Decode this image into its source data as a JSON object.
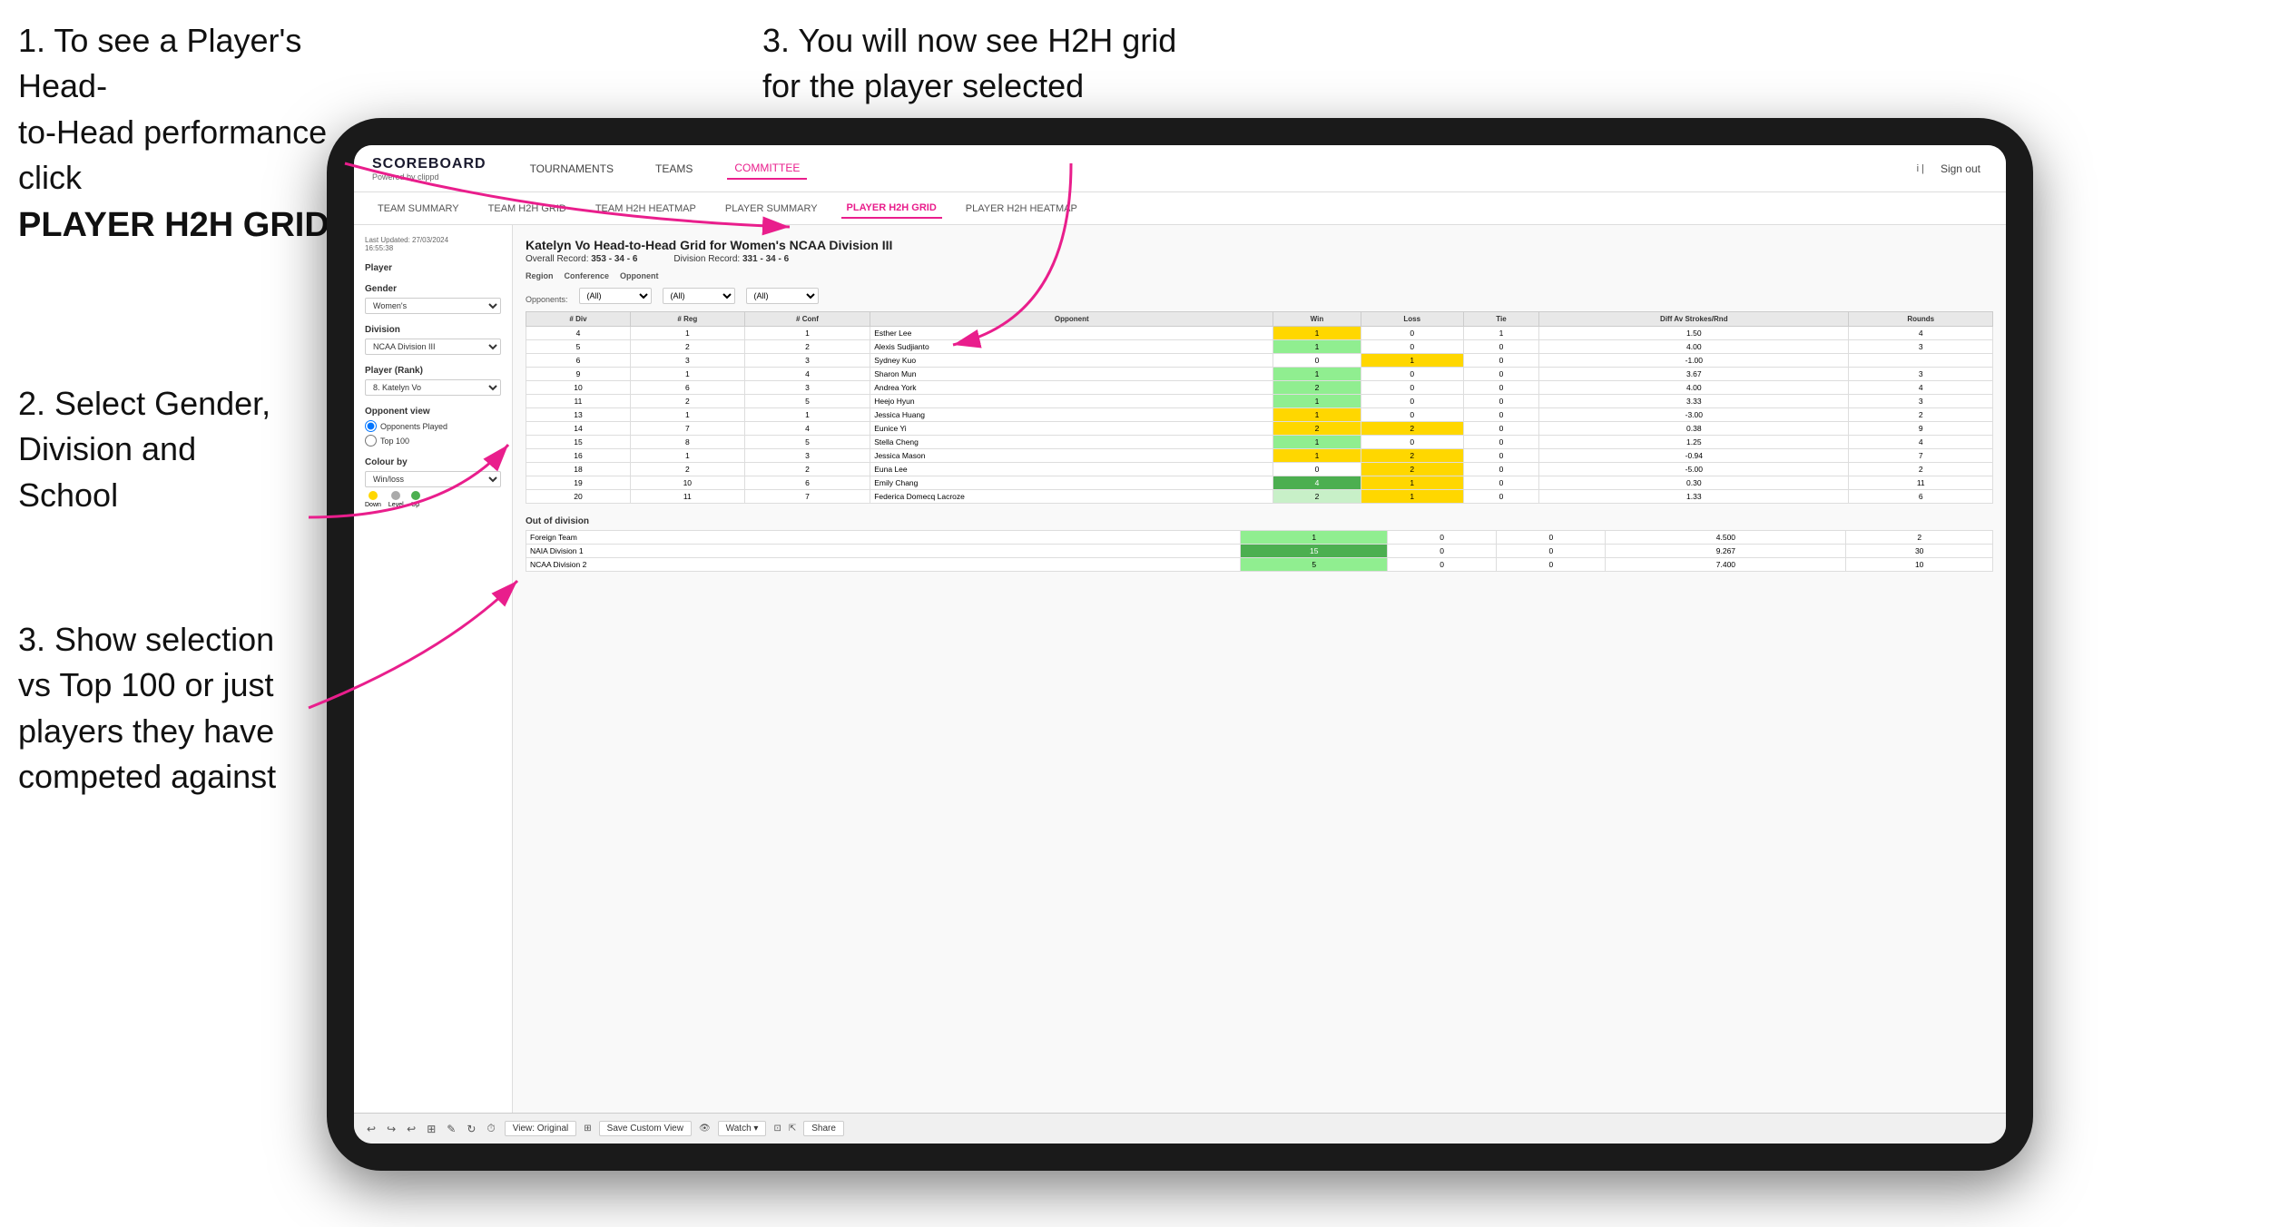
{
  "instructions": {
    "step1_line1": "1. To see a Player's Head-",
    "step1_line2": "to-Head performance click",
    "step1_bold": "PLAYER H2H GRID",
    "step2_line1": "2. Select Gender,",
    "step2_line2": "Division and",
    "step2_line3": "School",
    "step3_top_line1": "3. You will now see H2H grid",
    "step3_top_line2": "for the player selected",
    "step3_bottom_line1": "3. Show selection",
    "step3_bottom_line2": "vs Top 100 or just",
    "step3_bottom_line3": "players they have",
    "step3_bottom_line4": "competed against"
  },
  "nav": {
    "logo": "SCOREBOARD",
    "logo_sub": "Powered by clippd",
    "links": [
      "TOURNAMENTS",
      "TEAMS",
      "COMMITTEE"
    ],
    "active_link": "COMMITTEE",
    "sign_out": "Sign out"
  },
  "sub_nav": {
    "links": [
      "TEAM SUMMARY",
      "TEAM H2H GRID",
      "TEAM H2H HEATMAP",
      "PLAYER SUMMARY",
      "PLAYER H2H GRID",
      "PLAYER H2H HEATMAP"
    ],
    "active": "PLAYER H2H GRID"
  },
  "sidebar": {
    "timestamp": "Last Updated: 27/03/2024",
    "timestamp2": "16:55:38",
    "player_label": "Player",
    "gender_label": "Gender",
    "gender_value": "Women's",
    "division_label": "Division",
    "division_value": "NCAA Division III",
    "player_rank_label": "Player (Rank)",
    "player_rank_value": "8. Katelyn Vo",
    "opponent_view_label": "Opponent view",
    "opponent_played": "Opponents Played",
    "top_100": "Top 100",
    "colour_by_label": "Colour by",
    "colour_by_value": "Win/loss",
    "legend_down": "Down",
    "legend_level": "Level",
    "legend_up": "Up"
  },
  "grid": {
    "title": "Katelyn Vo Head-to-Head Grid for Women's NCAA Division III",
    "overall_record_label": "Overall Record:",
    "overall_record": "353 - 34 - 6",
    "division_record_label": "Division Record:",
    "division_record": "331 - 34 - 6",
    "region_label": "Region",
    "conference_label": "Conference",
    "opponent_label": "Opponent",
    "opponents_label": "Opponents:",
    "opponents_value": "(All)",
    "conference_value": "(All)",
    "opponent_value": "(All)",
    "col_headers": [
      "# Div",
      "# Reg",
      "# Conf",
      "Opponent",
      "Win",
      "Loss",
      "Tie",
      "Diff Av Strokes/Rnd",
      "Rounds"
    ],
    "rows": [
      {
        "div": 4,
        "reg": 1,
        "conf": 1,
        "opponent": "Esther Lee",
        "win": 1,
        "loss": 0,
        "tie": 1,
        "diff": "1.50",
        "rounds": 4,
        "win_color": "yellow",
        "loss_color": "",
        "tie_color": "yellow"
      },
      {
        "div": 5,
        "reg": 2,
        "conf": 2,
        "opponent": "Alexis Sudjianto",
        "win": 1,
        "loss": 0,
        "tie": 0,
        "diff": "4.00",
        "rounds": 3,
        "win_color": "green",
        "loss_color": "",
        "tie_color": ""
      },
      {
        "div": 6,
        "reg": 3,
        "conf": 3,
        "opponent": "Sydney Kuo",
        "win": 0,
        "loss": 1,
        "tie": 0,
        "diff": "-1.00",
        "rounds": "",
        "win_color": "",
        "loss_color": "yellow",
        "tie_color": ""
      },
      {
        "div": 9,
        "reg": 1,
        "conf": 4,
        "opponent": "Sharon Mun",
        "win": 1,
        "loss": 0,
        "tie": 0,
        "diff": "3.67",
        "rounds": 3,
        "win_color": "green",
        "loss_color": "",
        "tie_color": ""
      },
      {
        "div": 10,
        "reg": 6,
        "conf": 3,
        "opponent": "Andrea York",
        "win": 2,
        "loss": 0,
        "tie": 0,
        "diff": "4.00",
        "rounds": 4,
        "win_color": "green",
        "loss_color": "",
        "tie_color": ""
      },
      {
        "div": 11,
        "reg": 2,
        "conf": 5,
        "opponent": "Heejo Hyun",
        "win": 1,
        "loss": 0,
        "tie": 0,
        "diff": "3.33",
        "rounds": 3,
        "win_color": "green",
        "loss_color": "",
        "tie_color": ""
      },
      {
        "div": 13,
        "reg": 1,
        "conf": 1,
        "opponent": "Jessica Huang",
        "win": 1,
        "loss": 0,
        "tie": 0,
        "diff": "-3.00",
        "rounds": 2,
        "win_color": "yellow",
        "loss_color": "",
        "tie_color": ""
      },
      {
        "div": 14,
        "reg": 7,
        "conf": 4,
        "opponent": "Eunice Yi",
        "win": 2,
        "loss": 2,
        "tie": 0,
        "diff": "0.38",
        "rounds": 9,
        "win_color": "yellow",
        "loss_color": "yellow",
        "tie_color": ""
      },
      {
        "div": 15,
        "reg": 8,
        "conf": 5,
        "opponent": "Stella Cheng",
        "win": 1,
        "loss": 0,
        "tie": 0,
        "diff": "1.25",
        "rounds": 4,
        "win_color": "green",
        "loss_color": "",
        "tie_color": ""
      },
      {
        "div": 16,
        "reg": 1,
        "conf": 3,
        "opponent": "Jessica Mason",
        "win": 1,
        "loss": 2,
        "tie": 0,
        "diff": "-0.94",
        "rounds": 7,
        "win_color": "yellow",
        "loss_color": "yellow",
        "tie_color": ""
      },
      {
        "div": 18,
        "reg": 2,
        "conf": 2,
        "opponent": "Euna Lee",
        "win": 0,
        "loss": 2,
        "tie": 0,
        "diff": "-5.00",
        "rounds": 2,
        "win_color": "",
        "loss_color": "yellow",
        "tie_color": ""
      },
      {
        "div": 19,
        "reg": 10,
        "conf": 6,
        "opponent": "Emily Chang",
        "win": 4,
        "loss": 1,
        "tie": 0,
        "diff": "0.30",
        "rounds": 11,
        "win_color": "dark-green",
        "loss_color": "yellow",
        "tie_color": ""
      },
      {
        "div": 20,
        "reg": 11,
        "conf": 7,
        "opponent": "Federica Domecq Lacroze",
        "win": 2,
        "loss": 1,
        "tie": 0,
        "diff": "1.33",
        "rounds": 6,
        "win_color": "light-green",
        "loss_color": "yellow",
        "tie_color": ""
      }
    ],
    "out_of_division_title": "Out of division",
    "out_of_division_rows": [
      {
        "opponent": "Foreign Team",
        "win": 1,
        "loss": 0,
        "tie": 0,
        "diff": "4.500",
        "rounds": 2,
        "win_color": "green"
      },
      {
        "opponent": "NAIA Division 1",
        "win": 15,
        "loss": 0,
        "tie": 0,
        "diff": "9.267",
        "rounds": 30,
        "win_color": "dark-green"
      },
      {
        "opponent": "NCAA Division 2",
        "win": 5,
        "loss": 0,
        "tie": 0,
        "diff": "7.400",
        "rounds": 10,
        "win_color": "green"
      }
    ]
  },
  "toolbar": {
    "view_original": "View: Original",
    "save_custom": "Save Custom View",
    "watch": "Watch ▾",
    "share": "Share"
  }
}
